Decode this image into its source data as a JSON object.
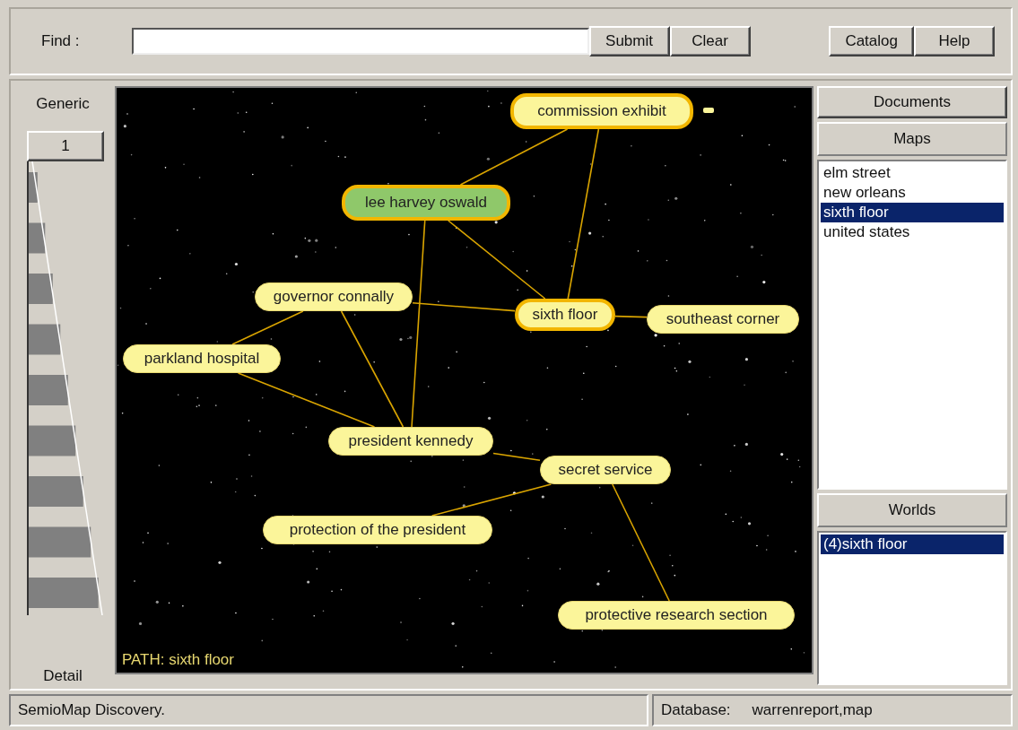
{
  "toolbar": {
    "find_label": "Find :",
    "buttons": [
      "Submit",
      "Clear"
    ],
    "right_buttons": [
      "Catalog",
      "Help"
    ]
  },
  "level_panel": {
    "top_label": "Generic",
    "level_button": "1",
    "bottom_label": "Detail"
  },
  "map": {
    "nodes": [
      {
        "label": "commission exhibit",
        "highlighted": true,
        "selected": false
      },
      {
        "label": "lee harvey oswald",
        "highlighted": true,
        "selected": true
      },
      {
        "label": "governor connally",
        "highlighted": false,
        "selected": false
      },
      {
        "label": "sixth floor",
        "highlighted": true,
        "selected": false
      },
      {
        "label": "southeast corner",
        "highlighted": false,
        "selected": false
      },
      {
        "label": "parkland hospital",
        "highlighted": false,
        "selected": false
      },
      {
        "label": "president kennedy",
        "highlighted": false,
        "selected": false
      },
      {
        "label": "secret service",
        "highlighted": false,
        "selected": false
      },
      {
        "label": "protection of the president",
        "highlighted": false,
        "selected": false
      },
      {
        "label": "protective research section",
        "highlighted": false,
        "selected": false
      }
    ],
    "path_label": "PATH: sixth floor"
  },
  "side_panel": {
    "documents_button": "Documents",
    "maps_header": "Maps",
    "maps": [
      {
        "label": "elm street",
        "selected": false
      },
      {
        "label": "new orleans",
        "selected": false
      },
      {
        "label": "sixth floor",
        "selected": true
      },
      {
        "label": "united states",
        "selected": false
      }
    ],
    "worlds_header": "Worlds",
    "worlds": [
      {
        "label": "(4)sixth floor",
        "selected": true
      }
    ]
  },
  "status_bar": {
    "message": "SemioMap Discovery.",
    "database_label": "Database:",
    "database_value": "warrenreport,map"
  }
}
